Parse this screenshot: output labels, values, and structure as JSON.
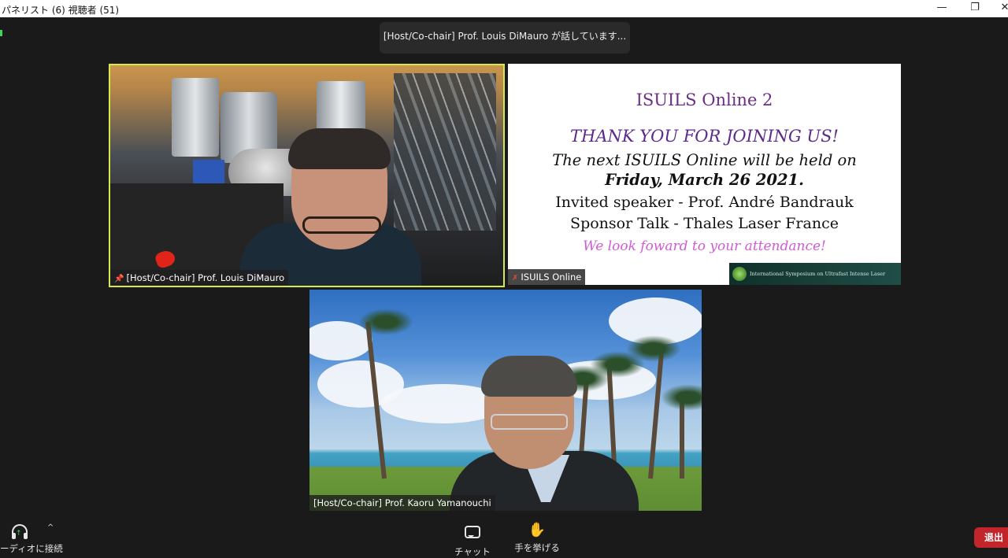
{
  "window": {
    "title": "パネリスト (6) 視聴者 (51)",
    "controls": {
      "minimize": "—",
      "restore": "❐",
      "close": "✕"
    }
  },
  "banner": {
    "speaking": "[Host/Co-chair]  Prof.  Louis  DiMauro が話しています..."
  },
  "tiles": {
    "dimauro": {
      "name": "[Host/Co-chair] Prof. Louis DiMauro",
      "pin_icon": "pin-icon",
      "active_speaker_color": "#d7e84f"
    },
    "slide": {
      "name": "ISUILS Online",
      "title": "ISUILS Online 2",
      "thanks": "THANK YOU FOR JOINING US!",
      "next": "The next ISUILS Online will be held on",
      "date": "Friday, March 26 2021.",
      "invited": "Invited speaker - Prof. André Bandrauk",
      "sponsor": "Sponsor Talk -  Thales Laser France",
      "look": "We look foward to your attendance!",
      "banner_text": "International Symposium on Ultrafast Intense Laser Science",
      "title_color": "#6b2d86",
      "look_color": "#d05ad6"
    },
    "yamanouchi": {
      "name": "[Host/Co-chair] Prof. Kaoru Yamanouchi"
    }
  },
  "toolbar": {
    "audio_label": "ーディオに接続",
    "chat_label": "チャット",
    "raise_hand_label": "手を挙げる",
    "leave_label": "退出",
    "leave_color": "#c2262a"
  }
}
